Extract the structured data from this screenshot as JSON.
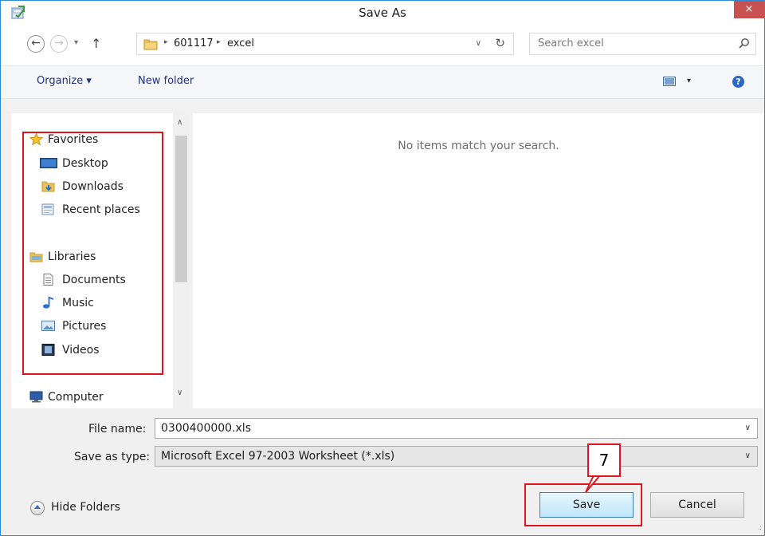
{
  "window": {
    "title": "Save As",
    "close_label": "×"
  },
  "nav": {
    "back_icon": "←",
    "forward_icon": "→",
    "recent_icon": "▾",
    "up_icon": "↑"
  },
  "address": {
    "crumbs": [
      "601117",
      "excel"
    ],
    "separator": "▸",
    "dropdown_icon": "∨",
    "refresh_icon": "↻"
  },
  "search": {
    "placeholder": "Search excel"
  },
  "toolbar": {
    "organize_label": "Organize ▾",
    "new_folder_label": "New folder",
    "view_dropdown": "▾",
    "help_label": "?"
  },
  "sidebar": {
    "favorites": {
      "label": "Favorites",
      "items": [
        {
          "label": "Desktop",
          "icon": "desktop-icon"
        },
        {
          "label": "Downloads",
          "icon": "downloads-icon"
        },
        {
          "label": "Recent places",
          "icon": "recent-places-icon"
        }
      ]
    },
    "libraries": {
      "label": "Libraries",
      "items": [
        {
          "label": "Documents",
          "icon": "documents-icon"
        },
        {
          "label": "Music",
          "icon": "music-icon"
        },
        {
          "label": "Pictures",
          "icon": "pictures-icon"
        },
        {
          "label": "Videos",
          "icon": "videos-icon"
        }
      ]
    },
    "computer": {
      "label": "Computer"
    },
    "scroll_up": "∧",
    "scroll_down": "∨"
  },
  "content": {
    "empty_message": "No items match your search."
  },
  "form": {
    "file_name_label": "File name:",
    "file_name_value": "0300400000.xls",
    "save_type_label": "Save as type:",
    "save_type_value": "Microsoft Excel 97-2003 Worksheet (*.xls)",
    "chevron": "∨"
  },
  "footer": {
    "hide_folders_label": "Hide Folders",
    "save_label": "Save",
    "cancel_label": "Cancel",
    "grip": ".:"
  },
  "annotation": {
    "step_number": "7",
    "highlight_color": "#e0141e"
  },
  "colors": {
    "accent": "#2b8ad6",
    "close": "#c75050",
    "link": "#1e3287"
  }
}
